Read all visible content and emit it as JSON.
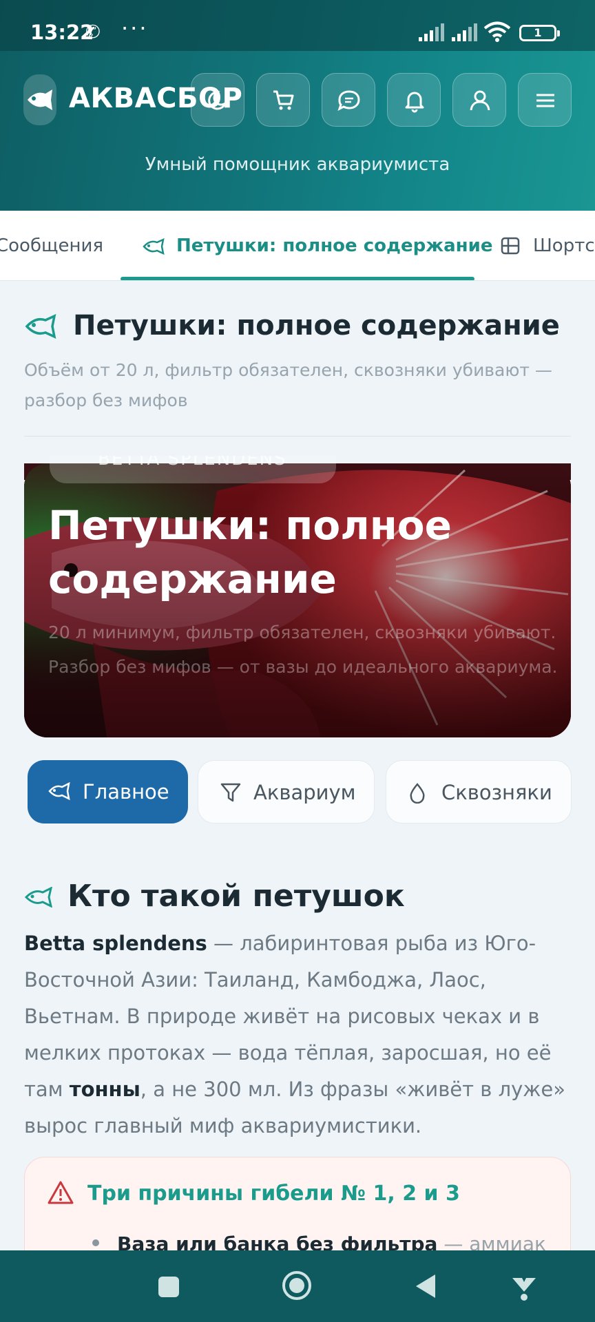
{
  "status_bar": {
    "time": "13:22",
    "dots": "···",
    "battery": "1"
  },
  "header": {
    "brand": "АКВАСБОР",
    "tagline": "Умный помощник аквариумиста",
    "buttons": [
      "theme-toggle",
      "cart",
      "messages",
      "notifications",
      "profile",
      "menu"
    ]
  },
  "tabs": [
    {
      "label": "Сообщения",
      "active": false
    },
    {
      "label": "Петушки: полное содержание",
      "active": true
    },
    {
      "label": "Шортс",
      "active": false
    }
  ],
  "page": {
    "title": "Петушки: полное содержание",
    "subtitle": "Объём от 20 л, фильтр обязателен, сквозняки убивают — разбор без мифов"
  },
  "hero": {
    "chip": "BETTA SPLENDENS",
    "title": "Петушки: полное содержание",
    "description": "20 л минимум, фильтр обязателен, сквозняки убивают. Разбор без мифов — от вазы до идеального аквариума."
  },
  "chips": [
    {
      "label": "Главное",
      "icon": "fish-icon",
      "active": true
    },
    {
      "label": "Аквариум",
      "icon": "filter-icon",
      "active": false
    },
    {
      "label": "Сквозняки",
      "icon": "drop-icon",
      "active": false
    }
  ],
  "section": {
    "title": "Кто такой петушок",
    "p_bold1": "Betta splendens",
    "p_text1": " — лабиринтовая рыба из Юго-Восточной Азии: Таиланд, Камбоджа, Лаос, Вьетнам. В природе живёт на рисовых чеках и в мелких протоках — вода тёплая, заросшая, но её там ",
    "p_bold2": "тонны",
    "p_text2": ", а не 300 мл. Из фразы «живёт в луже» вырос главный миф аквариумистики."
  },
  "alert": {
    "title": "Три причины гибели № 1, 2 и 3",
    "item_bold": "Ваза или банка без фильтра",
    "item_text": " — аммиак"
  },
  "colors": {
    "accent": "#1b9b8c",
    "header": "#11757a",
    "primary": "#1e6aa8"
  }
}
